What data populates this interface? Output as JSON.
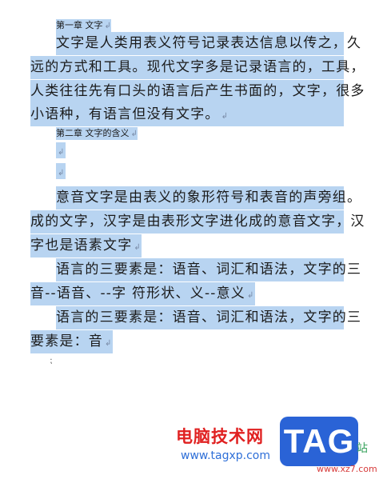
{
  "document": {
    "heading1": "第一章 文字",
    "para1": [
      "文字是人类用表义符号记录表达信息以传之，久",
      "远的方式和工具。现代文字多是记录语言的，工具，",
      "人类往往先有口头的语言后产生书面的，文字，很多",
      "小语种，有语言但没有文字。"
    ],
    "heading2": "第二章 文字的含义",
    "para2": [
      "意音文字是由表义的象形符号和表音的声旁组。",
      "成的文字，汉字是由表形文字进化成的意音文字，汉",
      "字也是语素文字"
    ],
    "para3": [
      "语言的三要素是：语音、词汇和语法，文字的三",
      "音--语音、--字 符形状、义--意义"
    ],
    "para4": [
      "语言的三要素是：语音、词汇和语法，文字的三",
      "要素是：音"
    ]
  },
  "watermark": {
    "site_name": "电脑技术网",
    "url": "www.tagxp.com",
    "badge": "TAG",
    "zhan": "站",
    "xz": "www.xz7.com"
  },
  "colors": {
    "selection": "#b8d4f1",
    "brand_blue": "#2a63d6",
    "brand_red": "#e02020"
  }
}
